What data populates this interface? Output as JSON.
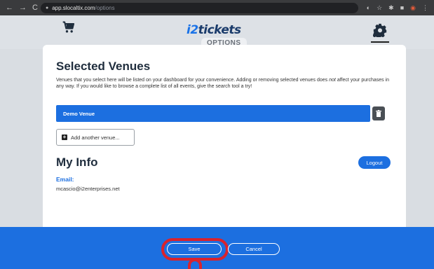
{
  "browser": {
    "url_host": "app.slocaltix.com",
    "url_path": "/options",
    "nav_back": "←",
    "nav_forward": "→",
    "nav_reload": "C"
  },
  "header": {
    "logo_prefix": "i2",
    "logo_suffix": "tickets",
    "tab_label": "OPTIONS"
  },
  "venues": {
    "title": "Selected Venues",
    "desc_part1": "Venues that you select here will be listed on your dashboard for your convenience. Adding or removing selected venues does ",
    "desc_emph": "not",
    "desc_part2": " affect your purchases in any way. If you would like to browse a complete list of all events, give the search tool a try!",
    "items": [
      {
        "name": "Demo Venue"
      }
    ],
    "add_label": "Add another venue..."
  },
  "myinfo": {
    "title": "My Info",
    "logout_label": "Logout",
    "email_label": "Email:",
    "email_value": "mcascio@i2enterprises.net"
  },
  "footer": {
    "save_label": "Save",
    "cancel_label": "Cancel"
  },
  "colors": {
    "brand_blue": "#1c6fe0",
    "logo_dark": "#1a3b6b",
    "highlight_red": "#d9232d"
  }
}
